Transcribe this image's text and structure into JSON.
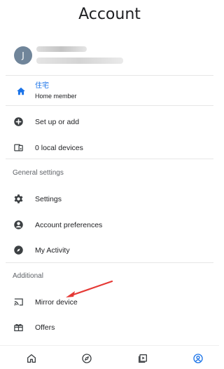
{
  "header": {
    "title": "Account"
  },
  "account": {
    "avatar_initial": "J"
  },
  "home": {
    "name": "住宅",
    "role": "Home member"
  },
  "menu": {
    "setup": "Set up or add",
    "local_devices": "0 local devices",
    "general_settings_title": "General settings",
    "settings": "Settings",
    "account_preferences": "Account preferences",
    "my_activity": "My Activity",
    "additional_title": "Additional",
    "mirror_device": "Mirror device",
    "offers": "Offers"
  },
  "icons": {
    "home": "home-icon",
    "setup": "plus-circle-icon",
    "local_devices": "devices-icon",
    "settings": "gear-icon",
    "account_preferences": "account-circle-icon",
    "my_activity": "compass-icon",
    "mirror_device": "cast-icon",
    "offers": "gift-icon",
    "nav_home": "home-outline-icon",
    "nav_discover": "compass-outline-icon",
    "nav_media": "play-library-icon",
    "nav_account": "account-outline-icon"
  },
  "colors": {
    "accent": "#1a73e8",
    "annotation_arrow": "#e53935"
  }
}
